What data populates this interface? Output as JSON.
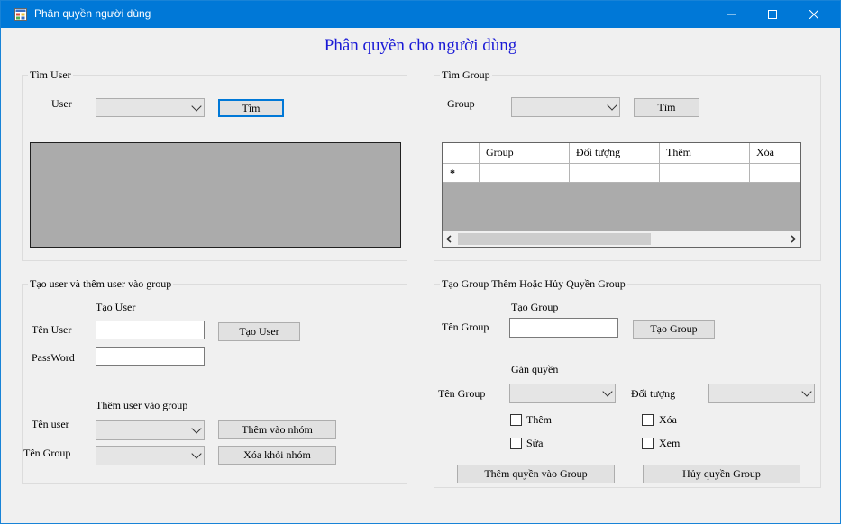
{
  "window": {
    "title": "Phân quyền người dùng",
    "minimize": "—",
    "maximize": "☐",
    "close": "✕"
  },
  "form_title": "Phân quyền cho người dùng",
  "find_user": {
    "group_label": "Tìm User",
    "user_label": "User",
    "search_button": "Tìm"
  },
  "find_group": {
    "group_label": "Tìm Group",
    "group_field_label": "Group",
    "search_button": "Tìm",
    "columns": [
      "Group",
      "Đối tượng",
      "Thêm",
      "Xóa"
    ],
    "new_row_marker": "*"
  },
  "create_user": {
    "group_label": "Tạo user và thêm user vào group",
    "section1_label": "Tạo User",
    "username_label": "Tên User",
    "password_label": "PassWord",
    "create_button": "Tạo User",
    "section2_label": "Thêm user vào group",
    "user_label": "Tên user",
    "group_label2": "Tên Group",
    "add_button": "Thêm vào nhóm",
    "remove_button": "Xóa khỏi nhóm"
  },
  "create_group": {
    "group_label": "Tạo Group Thêm Hoặc Hủy Quyền Group",
    "section1_label": "Tạo Group",
    "groupname_label": "Tên Group",
    "create_button": "Tạo Group",
    "section2_label": "Gán quyền",
    "assign_group_label": "Tên Group",
    "object_label": "Đối tượng",
    "chk_add": "Thêm",
    "chk_edit": "Sửa",
    "chk_delete": "Xóa",
    "chk_view": "Xem",
    "add_perm_button": "Thêm quyền vào Group",
    "remove_perm_button": "Hủy quyền Group"
  }
}
